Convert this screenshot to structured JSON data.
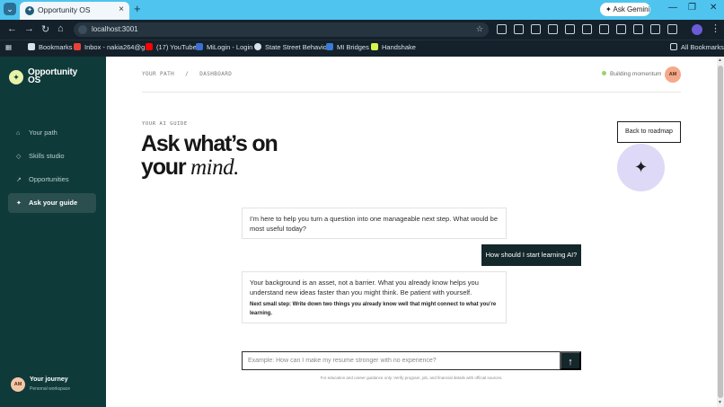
{
  "browser": {
    "tab_title": "Opportunity OS",
    "tab_icon_glyph": "✦",
    "ask_gemini": "Ask Gemini",
    "url": "localhost:3001",
    "bookmarks": [
      {
        "label": "Bookmarks",
        "icon": "star-icon",
        "color": "#d8e2e8"
      },
      {
        "label": "Inbox - nakia264@g...",
        "icon": "gmail-icon",
        "color": "#e94235"
      },
      {
        "label": "(17) YouTube",
        "icon": "youtube-icon",
        "color": "#ff0000"
      },
      {
        "label": "MiLogin - Login",
        "icon": "milogin-icon",
        "color": "#3b6fd1"
      },
      {
        "label": "State Street Behavio...",
        "icon": "globe-icon",
        "color": "#d8e2e8"
      },
      {
        "label": "MI Bridges",
        "icon": "mibridges-icon",
        "color": "#3a7bd5"
      },
      {
        "label": "Handshake",
        "icon": "handshake-icon",
        "color": "#d6f54c"
      }
    ],
    "all_bookmarks": "All Bookmarks"
  },
  "sidebar": {
    "logo_glyph": "✦",
    "logo_text": "Opportunity OS",
    "items": [
      {
        "label": "Your path",
        "icon": "home-icon",
        "glyph": "⌂",
        "active": false
      },
      {
        "label": "Skills studio",
        "icon": "diamond-icon",
        "glyph": "◇",
        "active": false
      },
      {
        "label": "Opportunities",
        "icon": "arrow-up-right-icon",
        "glyph": "↗",
        "active": false
      },
      {
        "label": "Ask your guide",
        "icon": "sparkle-icon",
        "glyph": "✦",
        "active": true
      }
    ],
    "journey": {
      "initials": "AM",
      "title": "Your journey",
      "subtitle": "Personal workspace"
    }
  },
  "header": {
    "breadcrumb": "YOUR PATH   /   DASHBOARD",
    "status": "Building momentum",
    "status_color": "#9ad36b",
    "avatar_initials": "AM"
  },
  "hero": {
    "eyebrow": "YOUR AI GUIDE",
    "line1": "Ask what’s on",
    "line2_prefix": "your ",
    "line2_italic": "mind.",
    "back_button": "Back to roadmap",
    "sparkle_glyph": "✦"
  },
  "chat": {
    "messages": [
      {
        "role": "assistant",
        "text": "I’m here to help you turn a question into one manageable next step. What would be most useful today?"
      },
      {
        "role": "user",
        "text": "How should I start learning AI?"
      },
      {
        "role": "assistant",
        "text": "Your background is an asset, not a barrier. What you already know helps you understand new ideas faster than you might think. Be patient with yourself.",
        "next_step": "Next small step: Write down two things you already know well that might connect to what you’re learning."
      }
    ],
    "input_placeholder": "Example: How can I make my resume stronger with no experience?",
    "send_glyph": "↑",
    "disclaimer": "For education and career guidance only. Verify program, job, and financial details with official sources."
  },
  "colors": {
    "sidebar_bg": "#0f3a3a",
    "accent_dark": "#14272b",
    "sparkle_bg": "#ddd9f7",
    "tabbar": "#4fc4ef"
  }
}
